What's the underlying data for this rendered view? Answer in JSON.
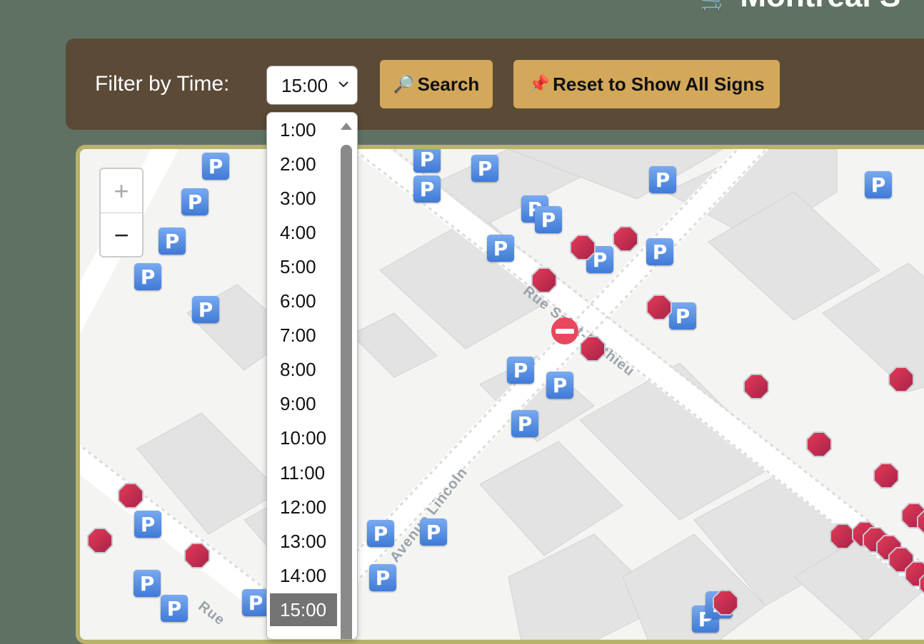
{
  "header": {
    "title": "Montreal S",
    "title_icon": "🛒"
  },
  "filter": {
    "label": "Filter by Time:",
    "selected": "15:00",
    "options": [
      "1:00",
      "2:00",
      "3:00",
      "4:00",
      "5:00",
      "6:00",
      "7:00",
      "8:00",
      "9:00",
      "10:00",
      "11:00",
      "12:00",
      "13:00",
      "14:00",
      "15:00"
    ]
  },
  "buttons": {
    "search_icon": "🔎",
    "search_label": "Search",
    "reset_icon": "📌",
    "reset_label": "Reset to Show All Signs"
  },
  "map": {
    "zoom_in": "+",
    "zoom_out": "−",
    "streets": [
      "Rue Saint-Mathieu",
      "Avenue Lincoln",
      "Rue"
    ],
    "parking_glyph": "P",
    "colors": {
      "parking": "#4a86e0",
      "stop": "#c92e52",
      "frame": "#b7b36a"
    }
  }
}
